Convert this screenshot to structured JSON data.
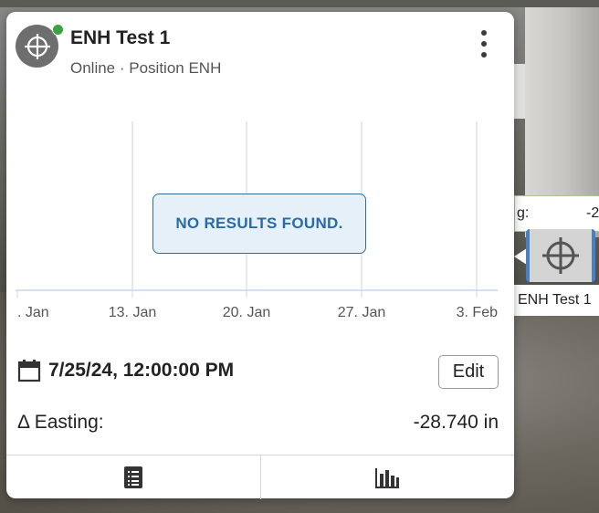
{
  "card": {
    "title": "ENH Test 1",
    "subtitle": "Online · Position ENH",
    "status_color": "#3aa33f",
    "no_results": "NO RESULTS FOUND.",
    "date": "7/25/24, 12:00:00 PM",
    "edit_label": "Edit",
    "easting_label": "Δ Easting:",
    "easting_value": "-28.740 in",
    "footer_tabs": [
      {
        "icon": "list-icon"
      },
      {
        "icon": "bar-chart-icon"
      }
    ]
  },
  "chart_data": {
    "type": "line",
    "title": "",
    "xlabel": "",
    "ylabel": "",
    "tick_labels": [
      ". Jan",
      "13. Jan",
      "20. Jan",
      "27. Jan",
      "3. Feb"
    ],
    "series": [],
    "grid": true
  },
  "side_marker": {
    "label_fragment": "g:",
    "value_fragment": "-2",
    "name": "ENH Test 1",
    "accent": "#4a7fc2"
  }
}
